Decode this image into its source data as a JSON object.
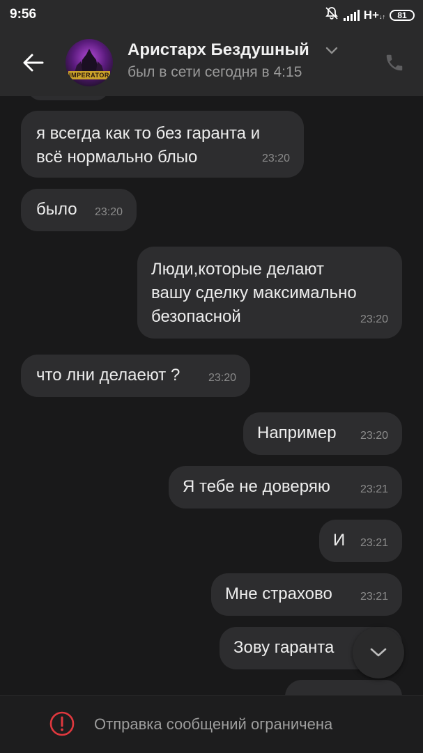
{
  "status_bar": {
    "time": "9:56",
    "network": "H+",
    "battery": "81"
  },
  "header": {
    "name": "Аристарх Бездушный",
    "status": "был в сети сегодня в 4:15",
    "avatar_text": "IMPERATOR"
  },
  "messages": [
    {
      "direction": "in",
      "text": "я всегда как то без гаранта и\nвсё нормально блыо",
      "time": "23:20"
    },
    {
      "direction": "in",
      "text": "было",
      "time": "23:20"
    },
    {
      "direction": "out",
      "text": "Люди,которые делают\nвашу сделку максимально\nбезопасной",
      "time": "23:20"
    },
    {
      "direction": "in",
      "text": "что лни делаеют ?",
      "time": "23:20"
    },
    {
      "direction": "out",
      "text": "Например",
      "time": "23:20"
    },
    {
      "direction": "out",
      "text": "Я тебе не доверяю",
      "time": "23:21"
    },
    {
      "direction": "out",
      "text": "И",
      "time": "23:21"
    },
    {
      "direction": "out",
      "text": "Мне страхово",
      "time": "23:21"
    },
    {
      "direction": "out",
      "text": "Зову гаранта",
      "time": ""
    }
  ],
  "footer": {
    "restriction_text": "Отправка сообщений ограничена"
  },
  "colors": {
    "background": "#19191a",
    "header": "#2a2a2b",
    "bubble": "#2d2d2f",
    "warning": "#e0383e"
  }
}
